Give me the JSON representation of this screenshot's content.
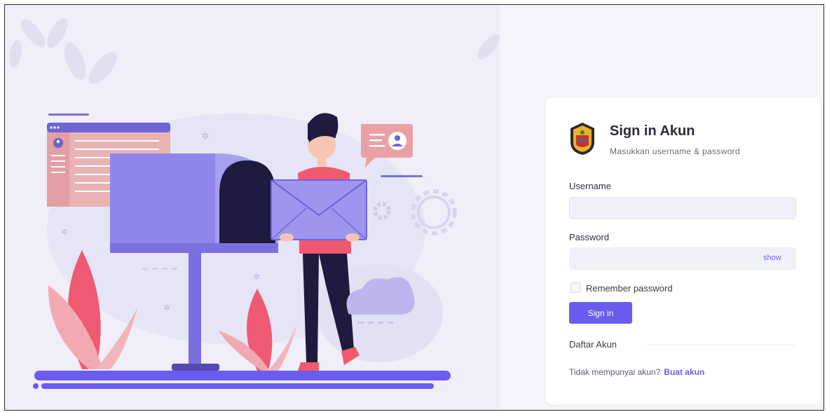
{
  "card": {
    "title": "Sign in Akun",
    "subtitle": "Masukkan username & password"
  },
  "form": {
    "username_label": "Username",
    "username_value": "",
    "password_label": "Password",
    "password_value": "",
    "show_label": "show",
    "remember_label": "Remember password",
    "remember_checked": false,
    "signin_label": "Sign in"
  },
  "register": {
    "section_title": "Daftar Akun",
    "prompt": "Tidak mempunyai akun?",
    "link_label": "Buat akun"
  },
  "colors": {
    "accent": "#6a5cf0",
    "background_left": "#efeef9",
    "background_right": "#f5f5f9",
    "card": "#ffffff"
  },
  "icons": [
    "logo-emblem",
    "mailbox-illustration",
    "envelope-icon",
    "gear-icon",
    "user-icon",
    "cloud-icon"
  ]
}
